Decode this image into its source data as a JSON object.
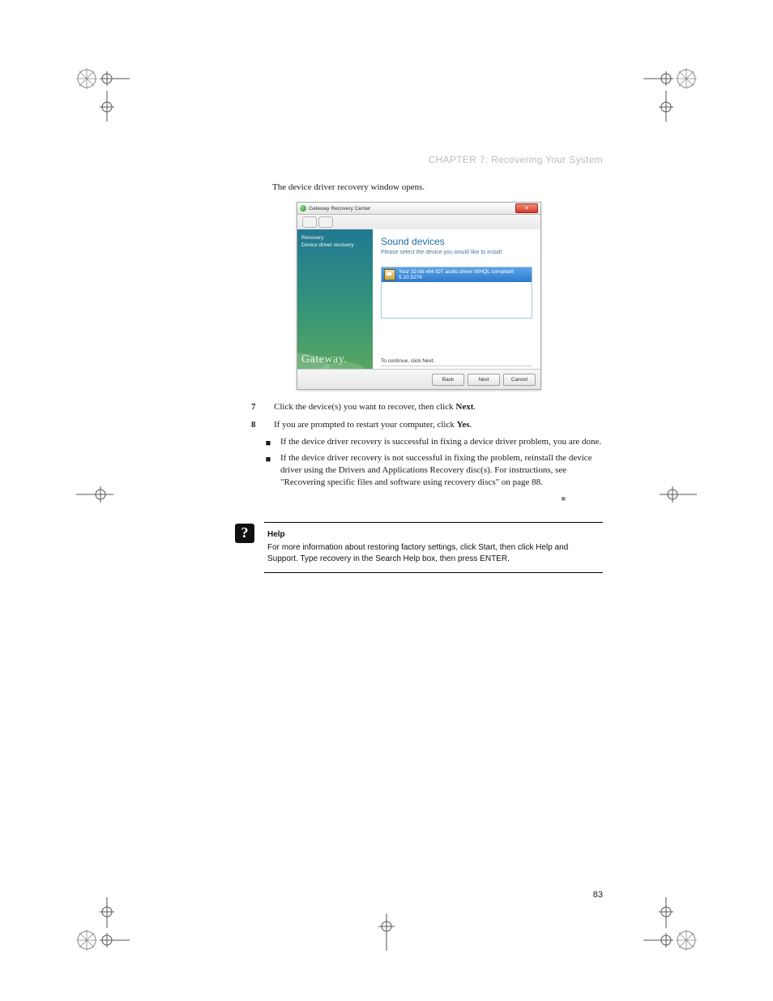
{
  "chapter_title": "CHAPTER 7: Recovering Your System",
  "intro_line": "The device driver recovery window opens.",
  "app": {
    "titlebar": "Gateway Recovery Center",
    "sidebar": {
      "items": [
        "Recovery",
        "Device driver recovery"
      ],
      "brand": "Gateway."
    },
    "main": {
      "heading": "Sound devices",
      "subtitle": "Please select the device you would like to install:",
      "device_item": "Your 32-bit x64 IDT audio driver WHQL compliant 5.10.5274",
      "continue_hint": "To continue, click Next."
    },
    "buttons": {
      "back": "Back",
      "next": "Next",
      "cancel": "Cancel"
    }
  },
  "step7": {
    "num": "7",
    "text_a": "Click the device(s) you want to recover, then click ",
    "text_b": "Next",
    "text_c": "."
  },
  "step8": {
    "num": "8",
    "text_a": "If you are prompted to restart your computer, click ",
    "text_b": "Yes",
    "text_c": "."
  },
  "bullets": [
    "If the device driver recovery is successful in fixing a device driver problem, you are done.",
    "If the device driver recovery is not successful in fixing the problem, reinstall the device driver using the Drivers and Applications Recovery disc(s). For instructions, see \"Recovering specific files and software using recovery discs\" on page 88."
  ],
  "end_mark": "■",
  "help": {
    "label": "Help",
    "text": "For more information about restoring factory settings, click Start, then click Help and Support. Type recovery in the Search Help box, then press ENTER."
  },
  "page_number": "83"
}
